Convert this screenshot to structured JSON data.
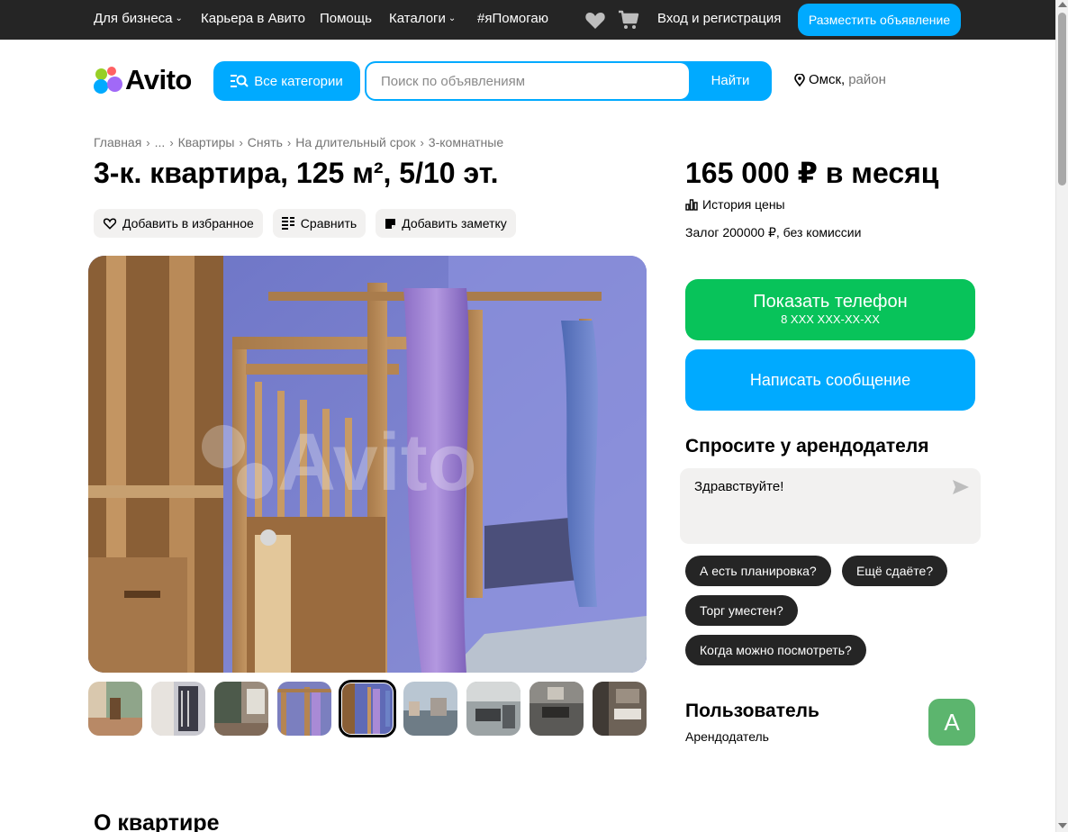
{
  "topbar": {
    "business": "Для бизнеса",
    "career": "Карьера в Авито",
    "help": "Помощь",
    "catalogs": "Каталоги",
    "ihelp": "#яПомогаю",
    "login": "Вход и регистрация",
    "post_ad": "Разместить объявление",
    "icons": [
      "heart-icon",
      "cart-icon"
    ]
  },
  "header": {
    "logo_text": "Avito",
    "categories_label": "Все категории",
    "search_placeholder": "Поиск по объявлениям",
    "search_button": "Найти",
    "city": "Омск,",
    "district": "район"
  },
  "breadcrumb": [
    "Главная",
    "...",
    "Квартиры",
    "Снять",
    "На длительный срок",
    "3-комнатные"
  ],
  "listing": {
    "title": "3-к. квартира, 125 м², 5/10 эт.",
    "actions": {
      "favorite": "Добавить в избранное",
      "compare": "Сравнить",
      "note": "Добавить заметку"
    },
    "thumbnail_count": 9,
    "active_thumbnail": 5,
    "about_title": "О квартире"
  },
  "sidebar": {
    "price": "165 000 ₽ в месяц",
    "price_history": "История цены",
    "deposit": "Залог 200000 ₽, без комиссии",
    "show_phone": "Показать телефон",
    "phone_mask": "8 XXX XXX-XX-XX",
    "write_message": "Написать сообщение",
    "ask_title": "Спросите у арендодателя",
    "ask_text": "Здравствуйте!",
    "chips": [
      "А есть планировка?",
      "Ещё сдаёте?",
      "Торг уместен?",
      "Когда можно посмотреть?"
    ],
    "user_name": "Пользователь",
    "user_role": "Арендодатель",
    "avatar_letter": "А"
  },
  "colors": {
    "accent_blue": "#00aaff",
    "green": "#08c35a",
    "dark": "#252525",
    "chip_bg": "#f2f1f0",
    "avatar": "#5cb56e"
  }
}
